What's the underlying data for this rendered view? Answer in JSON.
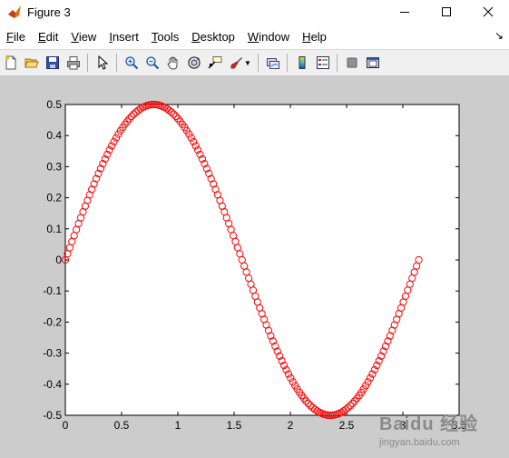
{
  "window": {
    "title": "Figure 3",
    "controls": [
      "minimize",
      "maximize",
      "close"
    ]
  },
  "menubar": {
    "items": [
      {
        "label": "File",
        "accel": "F"
      },
      {
        "label": "Edit",
        "accel": "E"
      },
      {
        "label": "View",
        "accel": "V"
      },
      {
        "label": "Insert",
        "accel": "I"
      },
      {
        "label": "Tools",
        "accel": "T"
      },
      {
        "label": "Desktop",
        "accel": "D"
      },
      {
        "label": "Window",
        "accel": "W"
      },
      {
        "label": "Help",
        "accel": "H"
      }
    ]
  },
  "toolbar": {
    "buttons": [
      "new-figure-icon",
      "open-file-icon",
      "save-icon",
      "print-icon",
      "pointer-icon",
      "zoom-in-icon",
      "zoom-out-icon",
      "pan-hand-icon",
      "rotate-3d-icon",
      "data-cursor-icon",
      "brush-icon",
      "link-plot-icon",
      "colorbar-icon",
      "legend-icon",
      "hide-plot-tools-icon",
      "show-plot-tools-icon"
    ]
  },
  "chart_data": {
    "type": "scatter",
    "marker": "circle-open",
    "color": "#ff0000",
    "function": "y = 0.5*sin(2x)",
    "x_range": [
      0,
      3.14159
    ],
    "n_points": 161,
    "xlim": [
      0,
      3.5
    ],
    "ylim": [
      -0.5,
      0.5
    ],
    "x_ticks": [
      "0",
      "0.5",
      "1",
      "1.5",
      "2",
      "2.5",
      "3",
      "3.5"
    ],
    "y_ticks": [
      "0.5",
      "0.4",
      "0.3",
      "0.2",
      "0.1",
      "0",
      "-0.1",
      "-0.2",
      "-0.3",
      "-0.4",
      "-0.5"
    ],
    "grid": false
  },
  "watermark": {
    "logo": "Baidu 经验",
    "url": "jingyan.baidu.com"
  }
}
